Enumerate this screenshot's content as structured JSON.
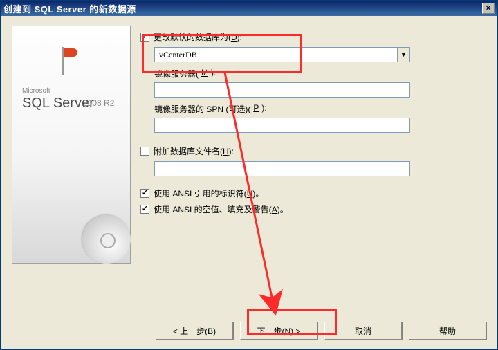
{
  "titlebar": {
    "title": "创建到 SQL Server 的新数据源",
    "close": "×"
  },
  "sideImage": {
    "microsoft": "Microsoft",
    "sqlserver": "SQL Server",
    "edition": "2008 R2"
  },
  "form": {
    "changeDefaultDb": {
      "label": "更改默认的数据库为(",
      "hot": "D",
      "tail": "):",
      "checked": true
    },
    "dbName": "vCenterDB",
    "mirrorServer": {
      "label": "镜像服务器(",
      "hot": "M",
      "tail": "):"
    },
    "mirrorSpn": {
      "label": "镜像服务器的 SPN (可选)(",
      "hot": "P",
      "tail": "):"
    },
    "attachDbFile": {
      "label": "附加数据库文件名(",
      "hot": "H",
      "tail": "):",
      "checked": false
    },
    "ansiQuoted": {
      "label": "使用 ANSI 引用的标识符(",
      "hot": "U",
      "tail": ")。",
      "checked": true
    },
    "ansiNulls": {
      "label": "使用 ANSI 的空值、填充及警告(",
      "hot": "A",
      "tail": ")。",
      "checked": true
    }
  },
  "buttons": {
    "back": "< 上一步(B)",
    "next": "下一步(N) >",
    "cancel": "取消",
    "help": "帮助"
  }
}
